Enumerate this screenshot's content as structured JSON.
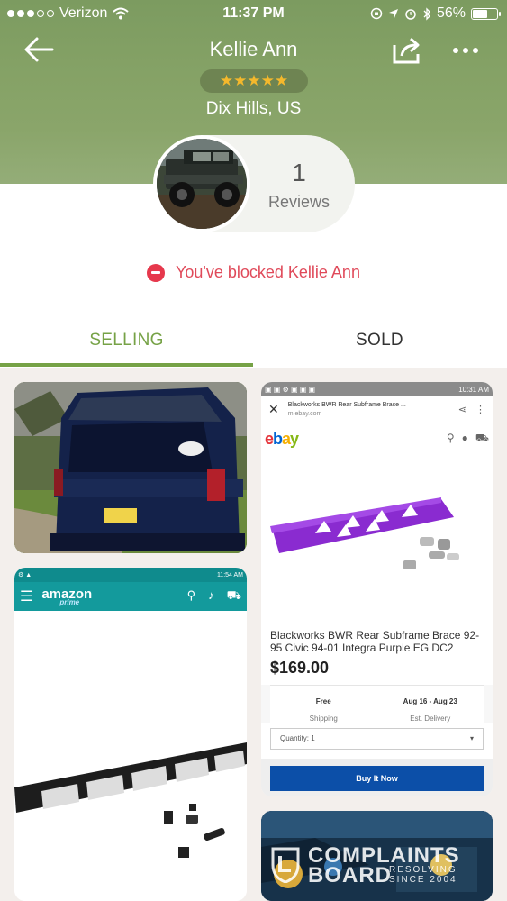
{
  "status_bar": {
    "carrier": "Verizon",
    "time": "11:37 PM",
    "battery_percent_text": "56%",
    "battery_level": 0.56
  },
  "header": {
    "name": "Kellie Ann",
    "rating_stars": 5,
    "stars_text": "★★★★★",
    "location": "Dix Hills, US",
    "star_color": "#f4b82c"
  },
  "reviews": {
    "count": "1",
    "label": "Reviews"
  },
  "blocked_message": "You've blocked Kellie Ann",
  "tabs": [
    {
      "label": "SELLING",
      "selected": true
    },
    {
      "label": "SOLD",
      "selected": false
    }
  ],
  "colors": {
    "accent": "#76a246",
    "blocked": "#e04a5a",
    "header_green": "#84a166"
  },
  "listings": {
    "ebay": {
      "header_text": "Blackworks BWR Rear Subframe Brace ...",
      "site": "m.ebay.com",
      "title": "Blackworks BWR Rear Subframe Brace 92-95 Civic 94-01 Integra Purple EG DC2",
      "price": "$169.00",
      "shipping_top": "Free",
      "shipping_bottom": "Shipping",
      "delivery_top": "Aug 16 - Aug 23",
      "delivery_bottom": "Est. Delivery",
      "quantity_label": "Quantity:",
      "quantity_value": "1",
      "buy_label": "Buy It Now",
      "status_time": "10:31 AM"
    },
    "amazon": {
      "logo": "amazon",
      "logo_sub": "prime",
      "status_time": "11:54 AM"
    }
  },
  "watermark": {
    "line1": "COMPLAINTS",
    "line2": "BOARD",
    "line3": "RESOLVING",
    "line4": "SINCE 2004"
  }
}
